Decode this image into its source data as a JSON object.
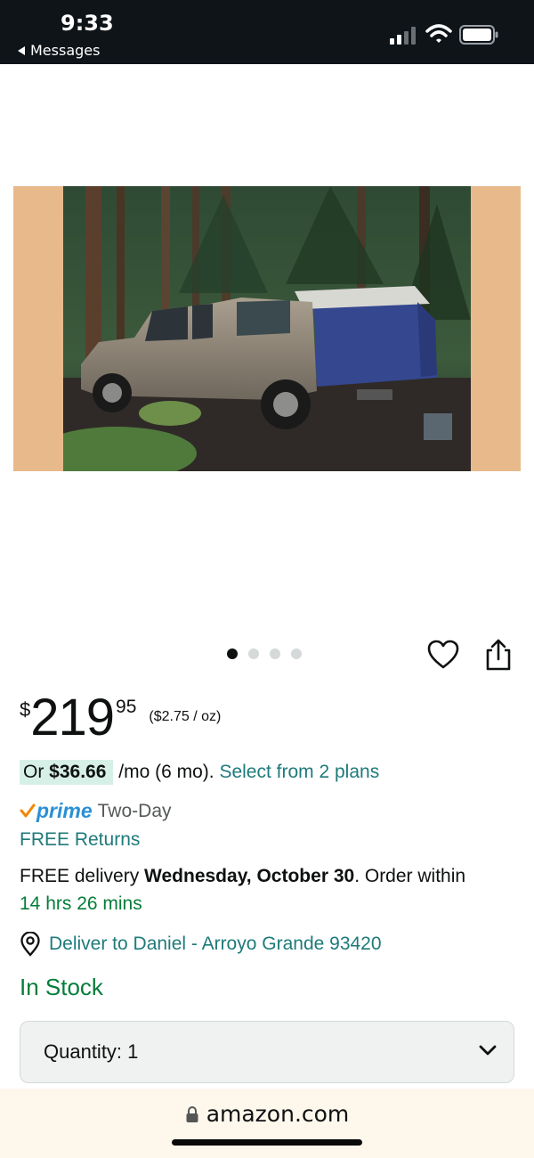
{
  "status_bar": {
    "time": "9:33",
    "back_label": "Messages",
    "icons": [
      "signal-icon",
      "wifi-icon",
      "battery-icon"
    ]
  },
  "product": {
    "image_alt": "Pickup truck with blue tent on truck bed in forest",
    "carousel": {
      "count": 4,
      "active": 1
    }
  },
  "price": {
    "currency": "$",
    "whole": "219",
    "fraction": "95",
    "unit_price": "($2.75 / oz)"
  },
  "installment": {
    "prefix": "Or ",
    "amount": "$36.66",
    "term": " /mo (6 mo). ",
    "link": "Select from 2 plans"
  },
  "prime": {
    "word": "prime",
    "label": "Two-Day"
  },
  "returns": "FREE Returns",
  "delivery": {
    "prefix": "FREE delivery ",
    "date": "Wednesday, October 30",
    "mid": ". Order within",
    "countdown": "14 hrs 26 mins"
  },
  "deliver_to": "Deliver to Daniel - Arroyo Grande 93420",
  "stock": "In Stock",
  "quantity": {
    "label": "Quantity:",
    "value": "1"
  },
  "browser": {
    "domain": "amazon.com"
  },
  "colors": {
    "link_teal": "#1f7a7a",
    "stock_green": "#067d3a",
    "prime_blue": "#2a8fd6",
    "prime_check": "#f08804",
    "installment_bg": "#d7f0e7"
  }
}
